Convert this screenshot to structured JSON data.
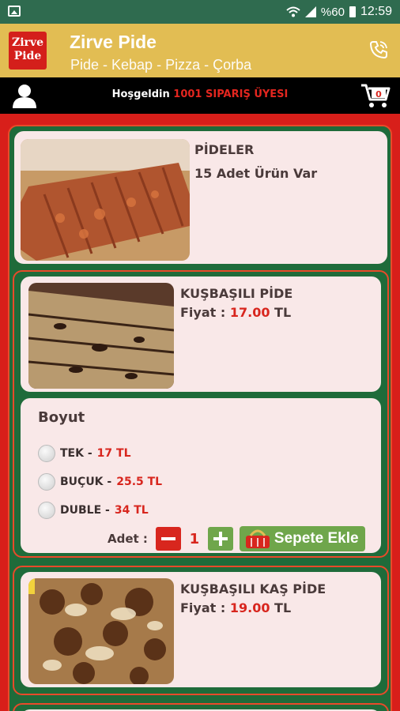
{
  "status_bar": {
    "battery": "%60",
    "time": "12:59"
  },
  "app": {
    "logo_line1": "Zirve",
    "logo_line2": "Pide",
    "title": "Zirve Pide",
    "subtitle": "Pide - Kebap - Pizza - Çorba"
  },
  "welcome": {
    "greeting": "Hoşgeldin",
    "member": "1001 SIPARIŞ ÜYESI",
    "cart_count": "0"
  },
  "category": {
    "title": "PİDELER",
    "count_text": "15 Adet Ürün Var"
  },
  "products": [
    {
      "name": "KUŞBAŞILI PİDE",
      "price_label": "Fiyat :",
      "price": "17.00",
      "currency": "TL",
      "size_heading": "Boyut",
      "options": [
        {
          "label": "TEK -",
          "price": "17 TL"
        },
        {
          "label": "BUÇUK -",
          "price": "25.5 TL"
        },
        {
          "label": "DUBLE -",
          "price": "34 TL"
        }
      ],
      "quantity_label": "Adet :",
      "quantity": "1",
      "add_button": "Sepete Ekle"
    },
    {
      "name": "KUŞBAŞILI KAŞ PİDE",
      "price_label": "Fiyat :",
      "price": "19.00",
      "currency": "TL"
    }
  ],
  "colors": {
    "status_bar": "#2f6b4f",
    "header": "#e2bd53",
    "background": "#d81f1a",
    "panel": "#1f6b3a",
    "card": "#f9e8e8",
    "accent_red": "#d8261e",
    "button_green": "#6fa64b"
  },
  "icons": [
    "image-icon",
    "wifi-icon",
    "signal-icon",
    "battery-icon",
    "phone-icon",
    "user-icon",
    "cart-icon",
    "basket-icon"
  ]
}
